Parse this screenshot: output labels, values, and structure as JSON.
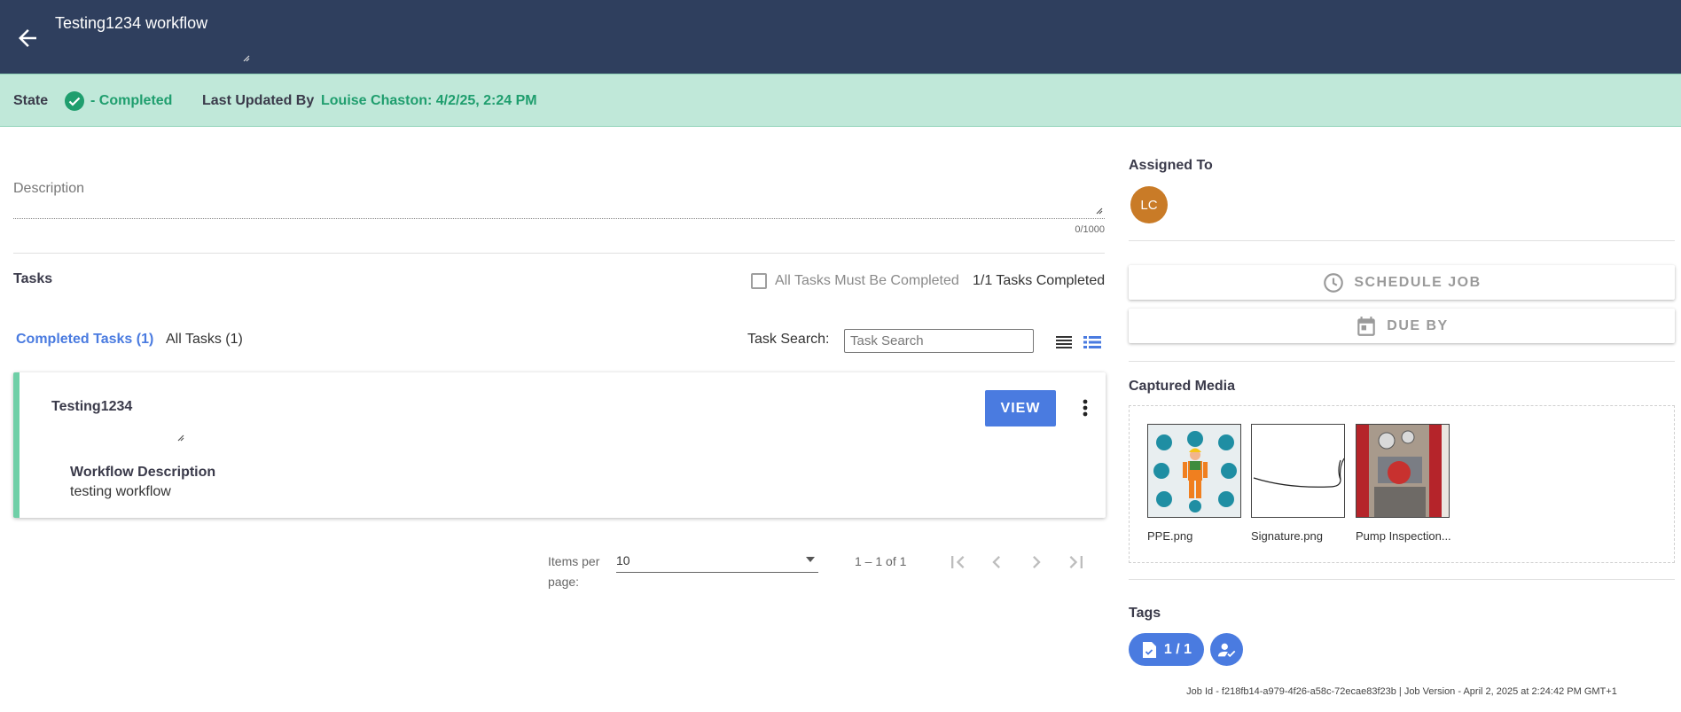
{
  "header": {
    "title": "Testing1234 workflow",
    "bg_color": "#2f3f5e"
  },
  "status": {
    "state_label": "State",
    "state_value": "- Completed",
    "updated_label": "Last Updated By",
    "updated_value": "Louise Chaston: 4/2/25, 2:24 PM",
    "bg_color": "#c0e8d9",
    "accent_color": "#1f9e6e"
  },
  "description": {
    "label": "Description",
    "counter": "0/1000"
  },
  "tasks": {
    "title": "Tasks",
    "must_complete_label": "All Tasks Must Be Completed",
    "completed_summary": "1/1 Tasks Completed",
    "tabs": [
      {
        "label": "Completed Tasks (1)",
        "active": true
      },
      {
        "label": "All Tasks (1)",
        "active": false
      }
    ],
    "search_label": "Task Search:",
    "search_placeholder": "Task Search",
    "items": [
      {
        "name": "Testing1234",
        "desc_label": "Workflow Description",
        "desc_value": "testing workflow",
        "view_label": "VIEW"
      }
    ]
  },
  "pagination": {
    "items_per_page_label": "Items per page:",
    "items_per_page_value": "10",
    "range": "1 – 1 of 1"
  },
  "assigned": {
    "title": "Assigned To",
    "initials": "LC",
    "avatar_color": "#c97b27"
  },
  "actions": {
    "schedule_label": "SCHEDULE JOB",
    "due_label": "DUE BY"
  },
  "media": {
    "title": "Captured Media",
    "items": [
      {
        "caption": "PPE.png",
        "kind": "ppe-image"
      },
      {
        "caption": "Signature.png",
        "kind": "signature-image"
      },
      {
        "caption": "Pump Inspection...",
        "kind": "pump-photo"
      }
    ]
  },
  "tags": {
    "title": "Tags",
    "chip_label": "1 / 1",
    "accent_color": "#4a7be0"
  },
  "footer": {
    "text": "Job Id - f218fb14-a979-4f26-a58c-72ecae83f23b | Job Version - April 2, 2025 at 2:24:42 PM GMT+1"
  }
}
